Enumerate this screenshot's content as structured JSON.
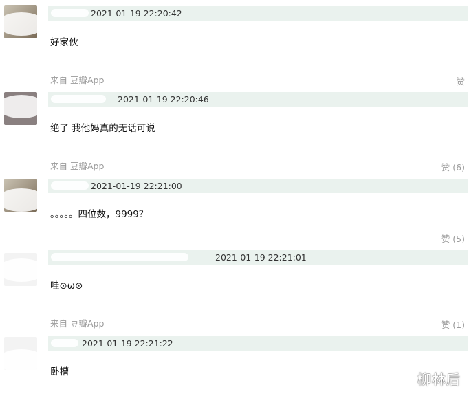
{
  "comments": [
    {
      "time": "2021-01-19 22:20:42",
      "text": "好家伙",
      "source": "来自 豆瓣App",
      "like": "赞"
    },
    {
      "time": "2021-01-19 22:20:46",
      "text": "绝了 我他妈真的无话可说",
      "source": "来自 豆瓣App",
      "like": "赞 (6)"
    },
    {
      "time": "2021-01-19 22:21:00",
      "text": "。。。。。四位数，9999？",
      "source": "",
      "like": "赞 (5)"
    },
    {
      "time": "2021-01-19 22:21:01",
      "text": "哇⊙ω⊙",
      "source": "来自 豆瓣App",
      "like": "赞 (1)"
    },
    {
      "time": "2021-01-19 22:21:22",
      "text": "卧槽",
      "source": "",
      "like": ""
    }
  ],
  "watermark": "柳林后"
}
